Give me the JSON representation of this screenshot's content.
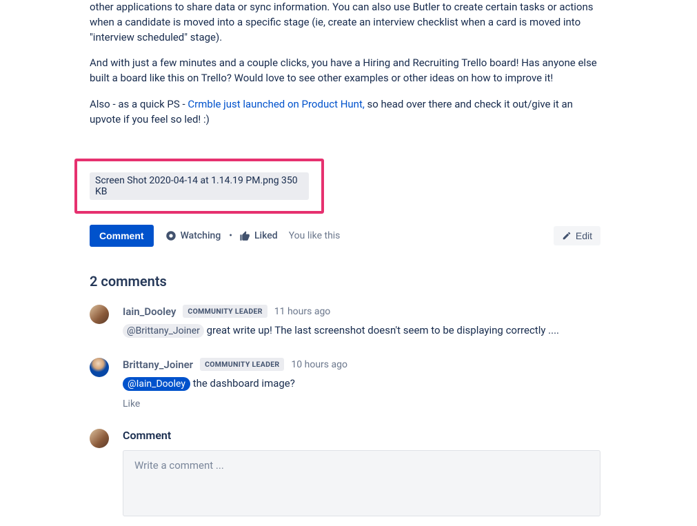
{
  "post": {
    "paragraph1": "other applications to share data or sync information. You can also use Butler to create certain tasks or actions when a candidate is moved into a specific stage (ie, create an interview checklist when a card is moved into \"interview scheduled\" stage).",
    "paragraph2": "And with just a few minutes and a couple clicks, you have a Hiring and Recruiting Trello board! Has anyone else built a board like this on Trello? Would love to see other examples or other ideas on how to improve it!",
    "paragraph3_prefix": "Also - as a quick PS - ",
    "paragraph3_link": "Crmble just launched on Product Hunt,",
    "paragraph3_suffix": " so head over there and check it out/give it an upvote if you feel so led! :)"
  },
  "attachment": {
    "label": "Screen Shot 2020-04-14 at 1.14.19 PM.png 350 KB"
  },
  "actions": {
    "comment_button": "Comment",
    "watching": "Watching",
    "liked": "Liked",
    "you_like": "You like this",
    "edit": "Edit"
  },
  "comments_header": "2 comments",
  "comments": [
    {
      "author": "Iain_Dooley",
      "badge": "COMMUNITY LEADER",
      "time": "11 hours ago",
      "mention": "@Brittany_Joiner",
      "text": " great write up! The last screenshot doesn't seem to be displaying correctly ...."
    },
    {
      "author": "Brittany_Joiner",
      "badge": "COMMUNITY LEADER",
      "time": "10 hours ago",
      "mention": "@Iain_Dooley",
      "text": " the dashboard image?",
      "like_label": "Like"
    }
  ],
  "comment_form": {
    "title": "Comment",
    "placeholder": "Write a comment ..."
  }
}
